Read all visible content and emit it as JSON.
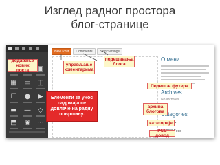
{
  "slide": {
    "title_line1": "Изглед радног простора",
    "title_line2": "блог-странице"
  },
  "blog_tabs": [
    {
      "label": "New Post",
      "active": true
    },
    {
      "label": "Comments",
      "active": false
    },
    {
      "label": "Blog Settings",
      "active": false
    }
  ],
  "sidebar": {
    "about_heading": "О мени",
    "archives_heading": "Archives",
    "archives_note": "No archives",
    "categories_heading": "Categories",
    "rss_label": "RSS Feed"
  },
  "callouts": {
    "add_post": "додавање нових поста",
    "manage_comments": "управљање коментарима",
    "blog_settings": "подешавања блога",
    "footer_settings": "Подеш.-е футера",
    "elements": "Елементи за унос садржаја се довлаче на радну површину.",
    "archive": "архива блогова",
    "categories": "категорије",
    "rss": "РСС довод"
  },
  "colors": {
    "callout_bg": "#fdf7c8",
    "callout_text": "#c8171f",
    "big_callout_bg": "#e42a2a",
    "active_tab": "#e06a20",
    "editor_panel": "#3a3a3a"
  },
  "icons": {
    "text_tool": "text-tool-icon",
    "image_tool": "image-tool-icon",
    "video_tool": "video-tool-icon",
    "rss": "rss-icon"
  }
}
